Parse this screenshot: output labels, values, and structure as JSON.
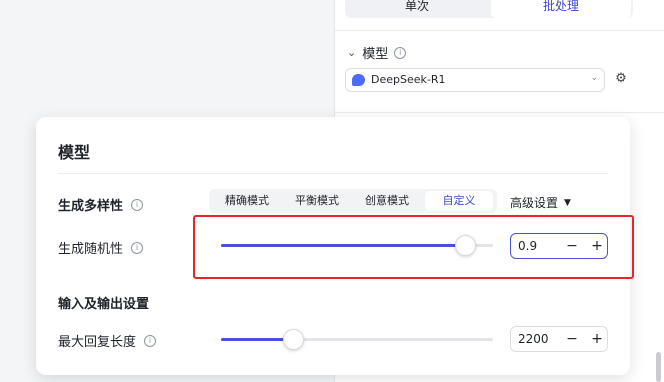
{
  "side": {
    "mode_tabs": [
      "单次",
      "批处理"
    ],
    "model_header": "模型",
    "model_name": "DeepSeek-R1"
  },
  "card": {
    "title": "模型",
    "diversity_label": "生成多样性",
    "modes": [
      "精确模式",
      "平衡模式",
      "创意模式",
      "自定义"
    ],
    "advanced_label": "高级设置",
    "randomness_label": "生成随机性",
    "randomness_value": "0.9",
    "randomness_fraction": 0.9,
    "io_section_label": "输入及输出设置",
    "max_length_label": "最大回复长度",
    "max_length_value": "2200",
    "max_length_fraction": 0.27,
    "minus": "−",
    "plus": "+"
  },
  "colors": {
    "accent": "#4a4fe0",
    "tab_active_text": "#3c46d8",
    "highlight_box": "#e8252b"
  },
  "icons": {
    "info": "info-icon",
    "gear": "gear-icon",
    "chevron": "chevron-down-icon",
    "caret": "caret-down-icon"
  }
}
